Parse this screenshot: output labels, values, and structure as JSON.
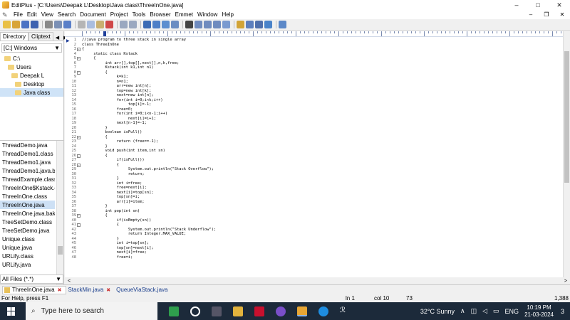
{
  "window": {
    "title": "EditPlus - [C:\\Users\\Deepak L\\Desktop\\Java class\\ThreeInOne.java]",
    "min_glyph": "–",
    "max_glyph": "□",
    "close_glyph": "✕"
  },
  "menu": {
    "items": [
      "File",
      "Edit",
      "View",
      "Search",
      "Document",
      "Project",
      "Tools",
      "Browser",
      "Emmet",
      "Window",
      "Help"
    ],
    "mdi_min": "–",
    "mdi_restore": "❐",
    "mdi_close": "✕"
  },
  "sidebar": {
    "tabs": [
      "Directory",
      "Cliptext"
    ],
    "arrow_left": "◀",
    "arrow_right": "▶",
    "drive": "[C:] Windows",
    "drive_arrow": "▼",
    "tree": [
      {
        "label": "C:\\",
        "indent": 0
      },
      {
        "label": "Users",
        "indent": 1
      },
      {
        "label": "Deepak L",
        "indent": 2
      },
      {
        "label": "Desktop",
        "indent": 3
      },
      {
        "label": "Java class",
        "indent": 4,
        "selected": true
      }
    ],
    "files": [
      "ThreadDemo.java",
      "ThreadDemo1.class",
      "ThreadDemo1.java",
      "ThreadDemo1.java.bak",
      "ThreadExample.class",
      "ThreeInOne$Kstack.cla",
      "ThreeInOne.class",
      "ThreeInOne.java",
      "ThreeInOne.java.bak",
      "TreeSetDemo.class",
      "TreeSetDemo.java",
      "Unique.class",
      "Unique.java",
      "URLify.class",
      "URLify.java"
    ],
    "selected_file_index": 7,
    "hscroll_left": "<",
    "hscroll_right": ">",
    "filter": "All Files (*.*)",
    "filter_arrow": "▼"
  },
  "editor": {
    "current_line_marker": "▶",
    "lines": [
      {
        "n": "1",
        "fold": "",
        "text": "//java program to three stack in single array",
        "cls": "cmt"
      },
      {
        "n": "2",
        "fold": "",
        "text": "class ThreeInOne",
        "cls": ""
      },
      {
        "n": "3",
        "fold": "−",
        "text": "{",
        "cls": ""
      },
      {
        "n": "4",
        "fold": "",
        "text": "     static class Kstack",
        "cls": ""
      },
      {
        "n": "5",
        "fold": "−",
        "text": "     {",
        "cls": ""
      },
      {
        "n": "6",
        "fold": "",
        "text": "          int arr[],top[],next[],n,k,free;",
        "cls": ""
      },
      {
        "n": "7",
        "fold": "",
        "text": "          Kstack(int k1,int n1)",
        "cls": ""
      },
      {
        "n": "8",
        "fold": "−",
        "text": "          {",
        "cls": ""
      },
      {
        "n": "9",
        "fold": "",
        "text": "               k=k1;",
        "cls": ""
      },
      {
        "n": "10",
        "fold": "",
        "text": "               n=n1;",
        "cls": ""
      },
      {
        "n": "11",
        "fold": "",
        "text": "               arr=new int[n];",
        "cls": ""
      },
      {
        "n": "12",
        "fold": "",
        "text": "               top=new int[k];",
        "cls": ""
      },
      {
        "n": "13",
        "fold": "",
        "text": "               next=new int[n];",
        "cls": ""
      },
      {
        "n": "14",
        "fold": "",
        "text": "               for(int i=0;i<k;i++)",
        "cls": ""
      },
      {
        "n": "15",
        "fold": "",
        "text": "                    top[i]=-1;",
        "cls": ""
      },
      {
        "n": "16",
        "fold": "",
        "text": "               free=0;",
        "cls": ""
      },
      {
        "n": "17",
        "fold": "",
        "text": "               for(int i=0;i<n-1;i++)",
        "cls": ""
      },
      {
        "n": "18",
        "fold": "",
        "text": "                    next[i]=i+1;",
        "cls": ""
      },
      {
        "n": "19",
        "fold": "",
        "text": "               next[n-1]=-1;",
        "cls": ""
      },
      {
        "n": "20",
        "fold": "",
        "text": "          }",
        "cls": ""
      },
      {
        "n": "21",
        "fold": "",
        "text": "          boolean isFull()",
        "cls": ""
      },
      {
        "n": "22",
        "fold": "−",
        "text": "          {",
        "cls": ""
      },
      {
        "n": "23",
        "fold": "",
        "text": "               return (free==-1);",
        "cls": ""
      },
      {
        "n": "24",
        "fold": "",
        "text": "          }",
        "cls": ""
      },
      {
        "n": "25",
        "fold": "",
        "text": "          void push(int item,int sn)",
        "cls": ""
      },
      {
        "n": "26",
        "fold": "−",
        "text": "          {",
        "cls": ""
      },
      {
        "n": "27",
        "fold": "",
        "text": "               if(isFull())",
        "cls": ""
      },
      {
        "n": "28",
        "fold": "−",
        "text": "               {",
        "cls": ""
      },
      {
        "n": "29",
        "fold": "",
        "text": "                    System.out.println(\"Stack Overflow\");",
        "cls": "str"
      },
      {
        "n": "30",
        "fold": "",
        "text": "                    return;",
        "cls": ""
      },
      {
        "n": "31",
        "fold": "",
        "text": "               }",
        "cls": ""
      },
      {
        "n": "32",
        "fold": "",
        "text": "               int i=free;",
        "cls": ""
      },
      {
        "n": "33",
        "fold": "",
        "text": "               free=next[i];",
        "cls": ""
      },
      {
        "n": "34",
        "fold": "",
        "text": "               next[i]=top[sn];",
        "cls": ""
      },
      {
        "n": "35",
        "fold": "",
        "text": "               top[sn]=i;",
        "cls": ""
      },
      {
        "n": "36",
        "fold": "",
        "text": "               arr[i]=item;",
        "cls": ""
      },
      {
        "n": "37",
        "fold": "",
        "text": "          }",
        "cls": ""
      },
      {
        "n": "38",
        "fold": "",
        "text": "          int pop(int sn)",
        "cls": ""
      },
      {
        "n": "39",
        "fold": "−",
        "text": "          {",
        "cls": ""
      },
      {
        "n": "40",
        "fold": "",
        "text": "               if(isEmpty(sn))",
        "cls": ""
      },
      {
        "n": "41",
        "fold": "−",
        "text": "               {",
        "cls": ""
      },
      {
        "n": "42",
        "fold": "",
        "text": "                    System.out.println(\"Stack Underflow\");",
        "cls": "str"
      },
      {
        "n": "43",
        "fold": "",
        "text": "                    return Integer.MAX_VALUE;",
        "cls": ""
      },
      {
        "n": "44",
        "fold": "",
        "text": "               }",
        "cls": ""
      },
      {
        "n": "45",
        "fold": "",
        "text": "               int i=top[sn];",
        "cls": ""
      },
      {
        "n": "46",
        "fold": "",
        "text": "               top[sn]=next[i];",
        "cls": ""
      },
      {
        "n": "47",
        "fold": "",
        "text": "               next[i]=free;",
        "cls": ""
      },
      {
        "n": "48",
        "fold": "",
        "text": "               free=i;",
        "cls": ""
      }
    ],
    "hscroll_left": "<",
    "hscroll_right": ">"
  },
  "doc_tabs": [
    {
      "label": "ThreeInOne.java",
      "active": true
    },
    {
      "label": "StackMin.java",
      "active": false
    },
    {
      "label": "QueueViaStack.java",
      "active": false
    }
  ],
  "doc_tab_close": "✖",
  "status": {
    "help": "For Help, press F1",
    "ln": "ln 1",
    "col": "col 10",
    "num": "73",
    "end": "1,388"
  },
  "taskbar": {
    "search_placeholder": "Type here to search",
    "search_icon": "search-icon",
    "weather": "32°C Sunny",
    "lang": "ENG",
    "time": "10:19 PM",
    "date": "21-03-2024",
    "notif_count": "3"
  },
  "colors": {
    "accent": "#1f3f9a",
    "taskbar": "#1c2a3a",
    "keyword": "#2244cc",
    "string": "#cc2222",
    "comment": "#2e8b2e"
  }
}
